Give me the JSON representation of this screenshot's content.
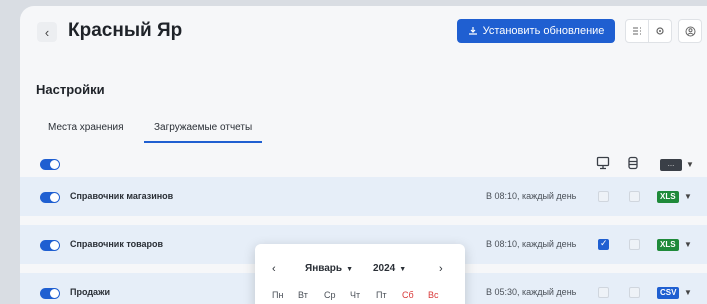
{
  "header": {
    "back_glyph": "‹",
    "title": "Красный Яр",
    "update_button_label": "Установить обновление",
    "update_icon": "download-icon",
    "icons": [
      "list-settings-icon",
      "gear-icon",
      "user-icon"
    ]
  },
  "settings": {
    "section_title": "Настройки",
    "tabs": [
      {
        "label": "Места хранения",
        "active": false
      },
      {
        "label": "Загружаемые отчеты",
        "active": true
      }
    ]
  },
  "toolbar": {
    "master_toggle_on": true,
    "columns": [
      "monitor-icon",
      "database-icon"
    ],
    "menu_glyph": "..."
  },
  "reports": [
    {
      "name": "Справочник магазинов",
      "schedule": "В 08:10, каждый день",
      "monitor": false,
      "database": false,
      "format": "XLS",
      "enabled": true
    },
    {
      "name": "Справочник товаров",
      "schedule": "В 08:10, каждый день",
      "monitor": true,
      "database": false,
      "format": "XLS",
      "enabled": true
    },
    {
      "name": "Продажи",
      "schedule": "В 05:30, каждый день",
      "monitor": false,
      "database": false,
      "format": "CSV",
      "enabled": true
    }
  ],
  "calendar": {
    "prev_glyph": "‹",
    "next_glyph": "›",
    "month": "Январь",
    "year": "2024",
    "weekdays": [
      "Пн",
      "Вт",
      "Ср",
      "Чт",
      "Пт",
      "Сб",
      "Вс"
    ],
    "weekend_color": "#d93838"
  },
  "colors": {
    "accent": "#1f5fd1",
    "xls": "#1f8a3a",
    "row_bg": "#e6eef8"
  }
}
